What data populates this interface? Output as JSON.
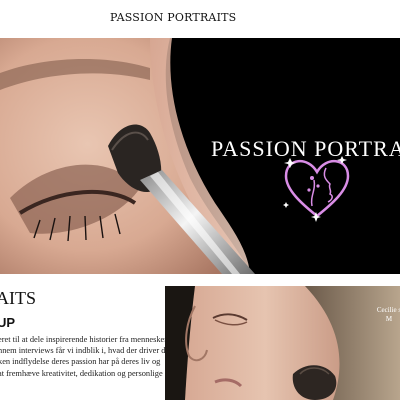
{
  "header": {
    "brand": "PASSION PORTRAITS"
  },
  "hero": {
    "title": "PASSION PORTRAITS",
    "logo_icon": "heart-face-logo",
    "accent_color": "#d98de6"
  },
  "section": {
    "title": "AITS",
    "subtitle": "UP",
    "lines": [
      "eret til at dele inspirerende historier fra mennesker",
      "nnem interviews får vi indblik i, hvad der driver dem,",
      "ken indflydelse deres passion har på deres liv og",
      "at fremhæve kreativitet, dedikation og personlige"
    ]
  },
  "feature": {
    "caption_line1": "Cecilie s",
    "caption_line2": "M"
  }
}
